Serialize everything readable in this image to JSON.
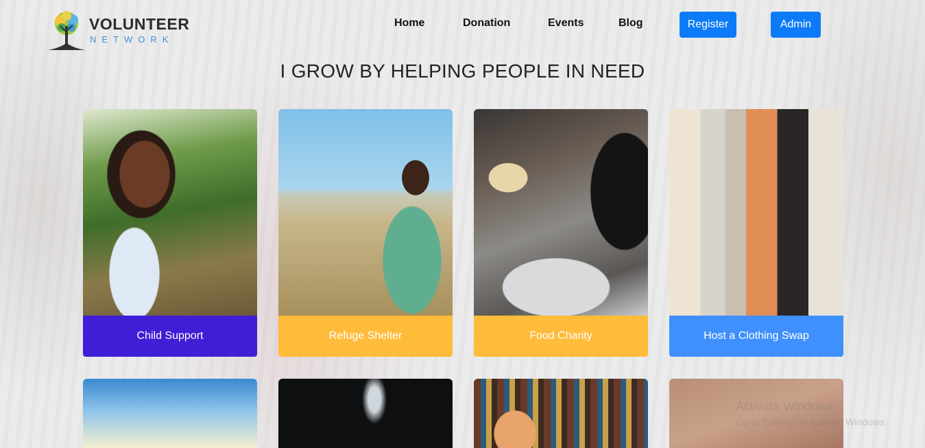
{
  "brand": {
    "title": "VOLUNTEER",
    "subtitle": "NETWORK"
  },
  "nav": {
    "links": [
      "Home",
      "Donation",
      "Events",
      "Blog"
    ],
    "register_label": "Register",
    "admin_label": "Admin"
  },
  "headline": "I GROW BY HELPING PEOPLE IN NEED",
  "cards": [
    {
      "label": "Child Support",
      "color": "#3f1ed6"
    },
    {
      "label": "Refuge Shelter",
      "color": "#ffbb3a"
    },
    {
      "label": "Food Charity",
      "color": "#ffbb3a"
    },
    {
      "label": "Host a Clothing Swap",
      "color": "#3f90fc"
    }
  ],
  "watermark": {
    "line1": "Activate Windows",
    "line2": "Go to Settings to activate Windows."
  }
}
